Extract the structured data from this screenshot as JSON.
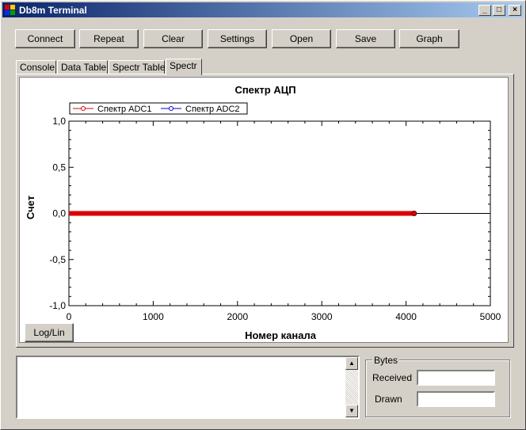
{
  "window": {
    "title": "Db8m Terminal",
    "controls": [
      "_",
      "□",
      "×"
    ]
  },
  "toolbar": [
    {
      "label": "Connect"
    },
    {
      "label": "Repeat"
    },
    {
      "label": "Clear"
    },
    {
      "label": "Settings"
    },
    {
      "label": "Open"
    },
    {
      "label": "Save"
    },
    {
      "label": "Graph"
    }
  ],
  "tabs": [
    {
      "label": "Console"
    },
    {
      "label": "Data Table"
    },
    {
      "label": "Spectr Table"
    },
    {
      "label": "Spectr",
      "active": true
    }
  ],
  "chart_data": {
    "type": "line",
    "title": "Спектр АЦП",
    "xlabel": "Номер канала",
    "ylabel": "Счет",
    "xlim": [
      0,
      5000
    ],
    "ylim": [
      -1.0,
      1.0
    ],
    "xticks": [
      "0",
      "1000",
      "2000",
      "3000",
      "4000",
      "5000"
    ],
    "yticks": [
      "1,0",
      "0,5",
      "0,0",
      "-0,5",
      "-1,0"
    ],
    "legend_position": "top-left",
    "series": [
      {
        "name": "Спектр ADC1",
        "color": "#dd0000",
        "x": [
          0,
          4096
        ],
        "values": [
          0,
          0
        ]
      },
      {
        "name": "Спектр ADC2",
        "color": "#0000dd",
        "x": [],
        "values": []
      }
    ],
    "zero_line_end": 5000
  },
  "plot_button": {
    "label": "Log/Lin"
  },
  "bytes_group": {
    "title": "Bytes",
    "received_label": "Received",
    "drawn_label": "Drawn",
    "received_value": "",
    "drawn_value": ""
  },
  "scroll": {
    "up": "▲",
    "down": "▼"
  }
}
